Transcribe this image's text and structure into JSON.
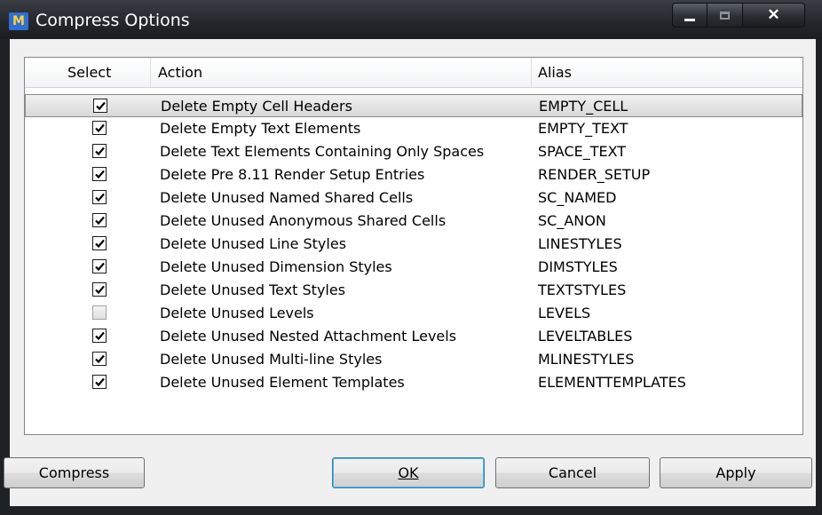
{
  "window": {
    "title": "Compress Options",
    "app_icon_glyph": "M"
  },
  "columns": {
    "select": "Select",
    "action": "Action",
    "alias": "Alias"
  },
  "rows": [
    {
      "checked": true,
      "action": "Delete Empty Cell Headers",
      "alias": "EMPTY_CELL"
    },
    {
      "checked": true,
      "action": "Delete Empty Text Elements",
      "alias": "EMPTY_TEXT"
    },
    {
      "checked": true,
      "action": "Delete Text Elements Containing Only Spaces",
      "alias": "SPACE_TEXT"
    },
    {
      "checked": true,
      "action": "Delete Pre 8.11 Render Setup Entries",
      "alias": "RENDER_SETUP"
    },
    {
      "checked": true,
      "action": "Delete Unused Named Shared Cells",
      "alias": "SC_NAMED"
    },
    {
      "checked": true,
      "action": "Delete Unused Anonymous Shared Cells",
      "alias": "SC_ANON"
    },
    {
      "checked": true,
      "action": "Delete Unused Line Styles",
      "alias": "LINESTYLES"
    },
    {
      "checked": true,
      "action": "Delete Unused Dimension Styles",
      "alias": "DIMSTYLES"
    },
    {
      "checked": true,
      "action": "Delete Unused Text Styles",
      "alias": "TEXTSTYLES"
    },
    {
      "checked": false,
      "action": "Delete Unused Levels",
      "alias": "LEVELS"
    },
    {
      "checked": true,
      "action": "Delete Unused Nested Attachment Levels",
      "alias": "LEVELTABLES"
    },
    {
      "checked": true,
      "action": "Delete Unused Multi-line Styles",
      "alias": "MLINESTYLES"
    },
    {
      "checked": true,
      "action": "Delete Unused Element Templates",
      "alias": "ELEMENTTEMPLATES"
    }
  ],
  "buttons": {
    "compress": "Compress",
    "ok": "OK",
    "cancel": "Cancel",
    "apply": "Apply"
  },
  "colors": {
    "titlebar": "#23262a",
    "dialog_bg": "#f0f0f0",
    "default_button_border": "#3c7fb1"
  }
}
